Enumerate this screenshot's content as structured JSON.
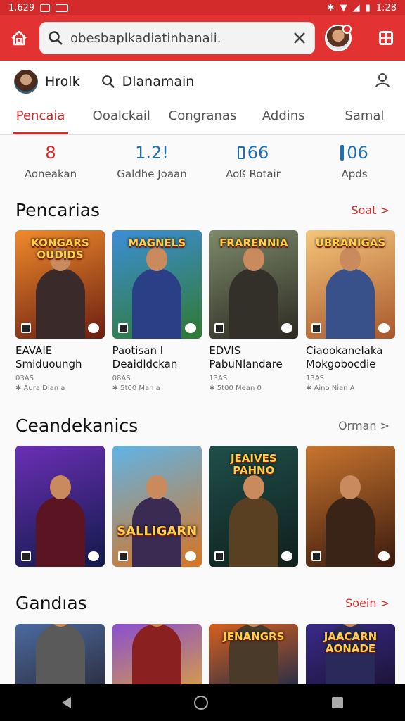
{
  "status": {
    "time": "1.629",
    "battery": "1:28"
  },
  "search": {
    "query": "obesbaplkadiatinhanaii."
  },
  "user": {
    "name": "Hrolk",
    "search_label": "Dlanamain"
  },
  "tabs": [
    {
      "label": "Pencaia",
      "active": true
    },
    {
      "label": "Ooalckail",
      "active": false
    },
    {
      "label": "Congranas",
      "active": false
    },
    {
      "label": "Addins",
      "active": false
    },
    {
      "label": "Samal",
      "active": false
    }
  ],
  "stats": [
    {
      "value": "8",
      "label": "Aoneakan",
      "icon": "pin-icon",
      "color": "#d32b2b"
    },
    {
      "value": "1.2!",
      "label": "Galdhe Joaan",
      "icon": "",
      "color": "#1f6fb3"
    },
    {
      "value": "66",
      "label": "Aoß Rotair",
      "icon": "battery-icon",
      "color": "#1f6fb3"
    },
    {
      "value": "06",
      "label": "Apds",
      "icon": "pen-icon",
      "color": "#1f6fb3"
    }
  ],
  "sections": [
    {
      "title": "Pencarias",
      "link": "Soat >",
      "link_color": "red",
      "cards": [
        {
          "art": "KONGARS\nOUDIDS",
          "name": "EAVAIE\nSmiduoungh",
          "meta1": "03AS",
          "meta2": "✱ Aura Dian a",
          "colors": [
            "#f08a2a",
            "#6a1e12"
          ],
          "fig": "#3a2a2a"
        },
        {
          "art": "MAGNELS",
          "name": "Paotisan l\nDeaidldckan",
          "meta1": "08AS",
          "meta2": "✱ 5t00 Man a",
          "colors": [
            "#3c8ed8",
            "#2f7a30"
          ],
          "fig": "#2a3f86"
        },
        {
          "art": "FRARENNIA",
          "name": "EDVIS\nPabuNlandare",
          "meta1": "13AS",
          "meta2": "✱ 5t00 Mean 0",
          "colors": [
            "#7d8a6a",
            "#2c2a22"
          ],
          "fig": "#33302a"
        },
        {
          "art": "UBRANIGAS",
          "name": "Ciaookanelaka\nMokgobocdie",
          "meta1": "13AS",
          "meta2": "✱ Aino Nian A",
          "colors": [
            "#f5c67a",
            "#a8572c"
          ],
          "fig": "#38518a"
        }
      ]
    },
    {
      "title": "Ceandekanics",
      "link": "Orman >",
      "link_color": "gray",
      "cards": [
        {
          "art": "",
          "name": "",
          "meta1": "",
          "meta2": "",
          "colors": [
            "#6b2fb5",
            "#101a4a"
          ],
          "fig": "#5a1422"
        },
        {
          "art": "SALLIGARN",
          "name": "",
          "meta1": "",
          "meta2": "",
          "colors": [
            "#5fb4e8",
            "#d9741f"
          ],
          "fig": "#3a2b52"
        },
        {
          "art": "JEAIVES\nPAHNO",
          "name": "",
          "meta1": "",
          "meta2": "",
          "colors": [
            "#1f4f4a",
            "#0f1f1c"
          ],
          "fig": "#5a4022"
        },
        {
          "art": "",
          "name": "",
          "meta1": "",
          "meta2": "",
          "colors": [
            "#c9752e",
            "#3a1a0e"
          ],
          "fig": "#3a2418"
        }
      ]
    },
    {
      "title": "Gandıas",
      "link": "Soein >",
      "link_color": "red",
      "cards": [
        {
          "art": "",
          "name": "",
          "meta1": "",
          "meta2": "",
          "colors": [
            "#4b6aa0",
            "#2b2b3a"
          ],
          "fig": "#5a5a5a"
        },
        {
          "art": "",
          "name": "",
          "meta1": "",
          "meta2": "",
          "colors": [
            "#8a4fd0",
            "#d8a040"
          ],
          "fig": "#8a2020"
        },
        {
          "art": "JENANGRS",
          "name": "",
          "meta1": "",
          "meta2": "",
          "colors": [
            "#d8601e",
            "#1a2a4a"
          ],
          "fig": "#4a3a2a"
        },
        {
          "art": "JAACARN\nAONADE",
          "name": "",
          "meta1": "",
          "meta2": "",
          "colors": [
            "#3a2a8a",
            "#1a1230"
          ],
          "fig": "#2a2a5a"
        }
      ]
    }
  ]
}
